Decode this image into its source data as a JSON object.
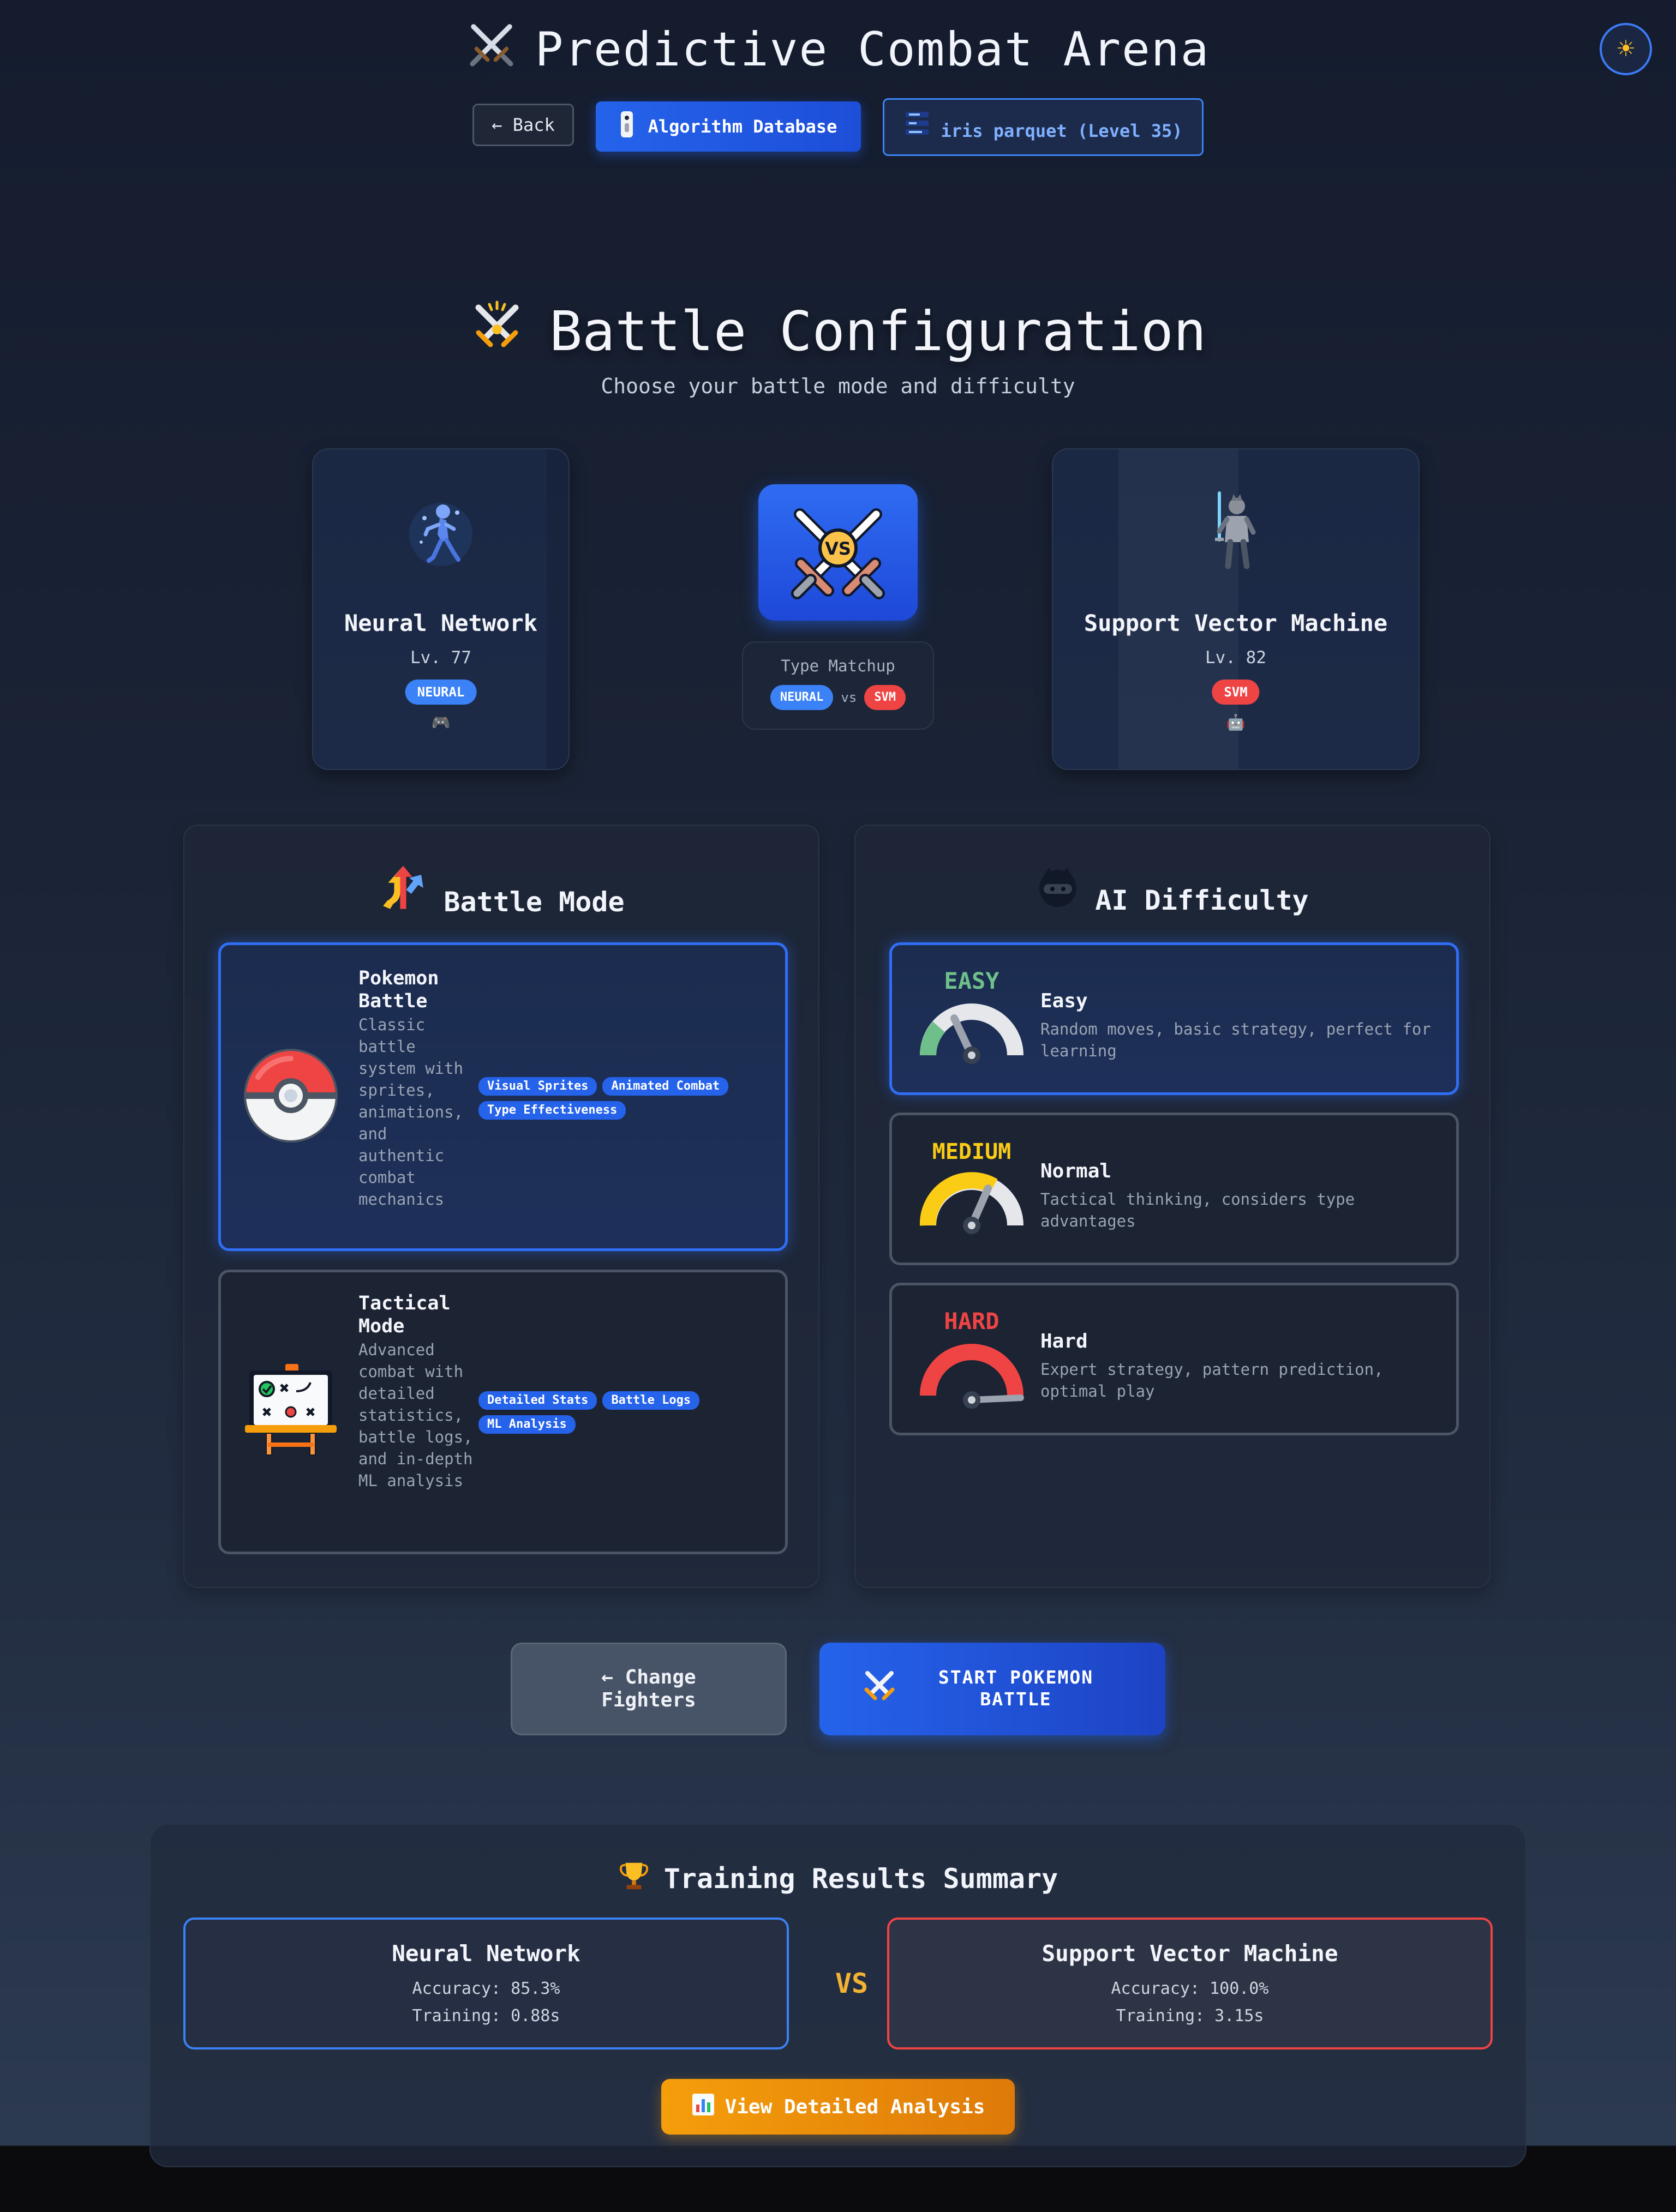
{
  "header": {
    "title": "Predictive Combat Arena",
    "theme_toggle_icon": "sun-icon",
    "back_label": "← Back",
    "algo_db_label": "Algorithm Database",
    "user_label": "iris parquet (Level 35)"
  },
  "config": {
    "title": "Battle Configuration",
    "subtitle": "Choose your battle mode and difficulty"
  },
  "fighters": {
    "left": {
      "name": "Neural Network",
      "level": "Lv. 77",
      "type": "NEURAL",
      "accent": "#3b82f6"
    },
    "right": {
      "name": "Support Vector Machine",
      "level": "Lv. 82",
      "type": "SVM",
      "accent": "#ef4444"
    }
  },
  "matchup": {
    "label": "Type Matchup",
    "left_type": "NEURAL",
    "vs": "vs",
    "right_type": "SVM"
  },
  "battle_mode": {
    "title": "Battle Mode",
    "modes": [
      {
        "name": "Pokemon Battle",
        "description": "Classic battle system with sprites, animations, and authentic combat mechanics",
        "tags": [
          "Visual Sprites",
          "Animated Combat",
          "Type Effectiveness"
        ],
        "selected": true,
        "icon": "pokeball-icon"
      },
      {
        "name": "Tactical Mode",
        "description": "Advanced combat with detailed statistics, battle logs, and in-depth ML analysis",
        "tags": [
          "Detailed Stats",
          "Battle Logs",
          "ML Analysis"
        ],
        "selected": false,
        "icon": "strategy-board-icon"
      }
    ]
  },
  "difficulty": {
    "title": "AI Difficulty",
    "levels": [
      {
        "badge": "EASY",
        "name": "Easy",
        "description": "Random moves, basic strategy, perfect for learning",
        "selected": true,
        "color": "#6fbf8a"
      },
      {
        "badge": "MEDIUM",
        "name": "Normal",
        "description": "Tactical thinking, considers type advantages",
        "selected": false,
        "color": "#facc15"
      },
      {
        "badge": "HARD",
        "name": "Hard",
        "description": "Expert strategy, pattern prediction, optimal play",
        "selected": false,
        "color": "#ef4444"
      }
    ]
  },
  "actions": {
    "change_label": "← Change Fighters",
    "start_label": "START POKEMON BATTLE"
  },
  "results": {
    "title": "Training Results Summary",
    "vs": "VS",
    "left": {
      "name": "Neural Network",
      "accuracy": "Accuracy: 85.3%",
      "training": "Training: 0.88s"
    },
    "right": {
      "name": "Support Vector Machine",
      "accuracy": "Accuracy: 100.0%",
      "training": "Training: 3.15s"
    },
    "analysis_label": "View Detailed Analysis"
  }
}
